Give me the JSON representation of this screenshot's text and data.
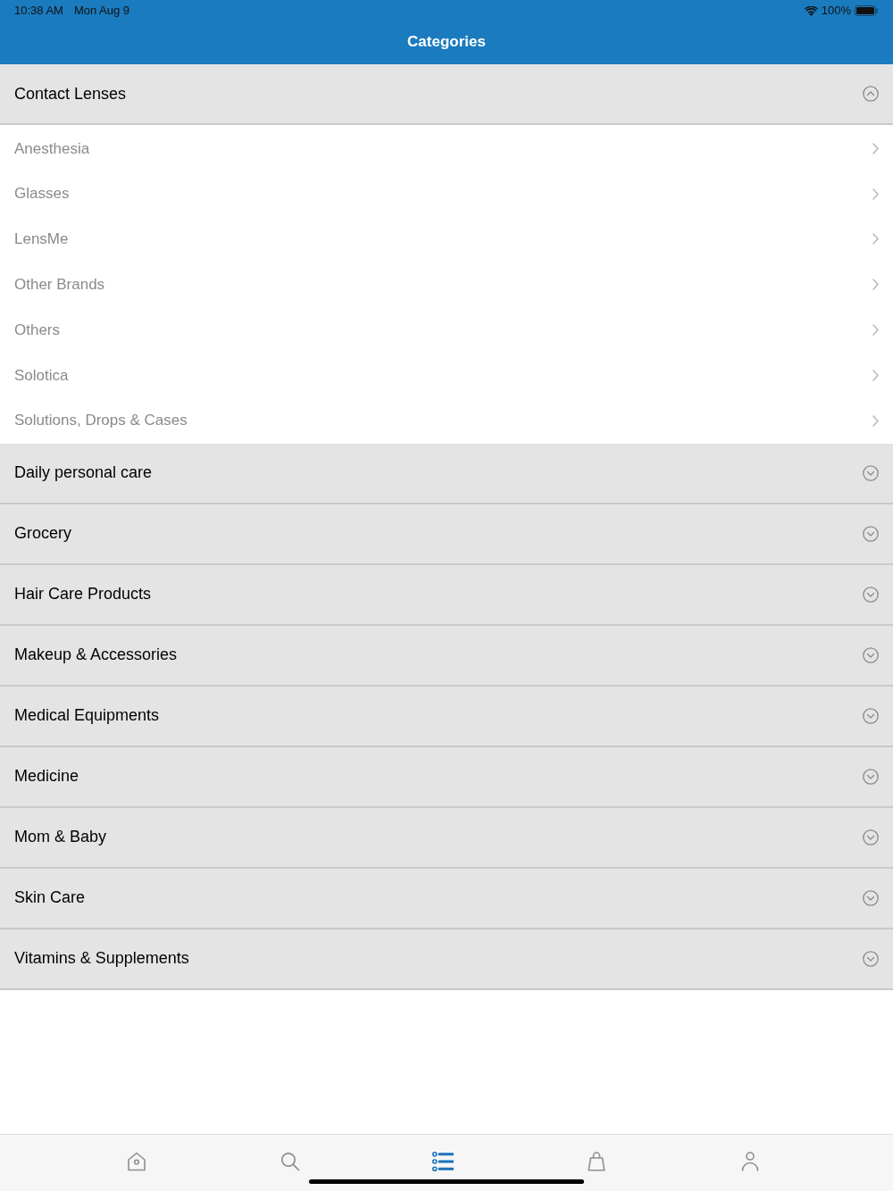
{
  "status_bar": {
    "time": "10:38 AM",
    "date": "Mon Aug 9",
    "battery": "100%"
  },
  "nav_bar": {
    "title": "Categories"
  },
  "categories": [
    {
      "label": "Contact Lenses",
      "expanded": true,
      "children": [
        {
          "label": "Anesthesia"
        },
        {
          "label": "Glasses"
        },
        {
          "label": "LensMe"
        },
        {
          "label": "Other Brands"
        },
        {
          "label": "Others"
        },
        {
          "label": "Solotica"
        },
        {
          "label": "Solutions, Drops & Cases"
        }
      ]
    },
    {
      "label": "Daily personal care",
      "expanded": false
    },
    {
      "label": "Grocery",
      "expanded": false
    },
    {
      "label": "Hair Care Products",
      "expanded": false
    },
    {
      "label": "Makeup & Accessories",
      "expanded": false
    },
    {
      "label": "Medical Equipments",
      "expanded": false
    },
    {
      "label": "Medicine",
      "expanded": false
    },
    {
      "label": "Mom & Baby",
      "expanded": false
    },
    {
      "label": "Skin Care",
      "expanded": false
    },
    {
      "label": "Vitamins & Supplements",
      "expanded": false
    }
  ],
  "tab_bar": [
    {
      "kind": "home",
      "selected": false
    },
    {
      "kind": "search",
      "selected": false
    },
    {
      "kind": "categories",
      "selected": true
    },
    {
      "kind": "bag",
      "selected": false
    },
    {
      "kind": "profile",
      "selected": false
    }
  ]
}
